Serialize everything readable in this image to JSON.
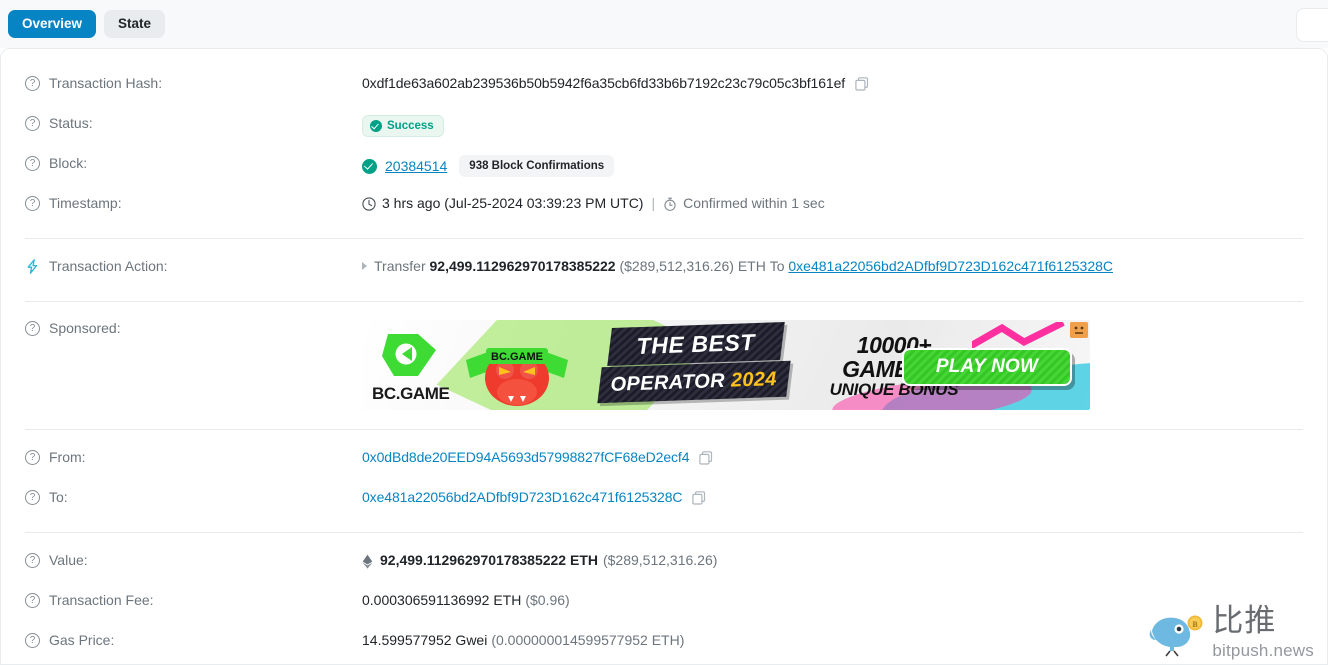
{
  "tabs": [
    {
      "label": "Overview",
      "active": true
    },
    {
      "label": "State",
      "active": false
    }
  ],
  "labels": {
    "transaction_hash": "Transaction Hash:",
    "status": "Status:",
    "block": "Block:",
    "timestamp": "Timestamp:",
    "transaction_action": "Transaction Action:",
    "sponsored": "Sponsored:",
    "from": "From:",
    "to": "To:",
    "value": "Value:",
    "transaction_fee": "Transaction Fee:",
    "gas_price": "Gas Price:"
  },
  "help_icon": "?",
  "transaction": {
    "hash": "0xdf1de63a602ab239536b50b5942f6a35cb6fd33b6b7192c23c79c05c3bf161ef",
    "status_text": "Success",
    "block_number": "20384514",
    "confirmations": "938 Block Confirmations",
    "timestamp_relative": "3 hrs ago (Jul-25-2024 03:39:23 PM UTC)",
    "timestamp_separator": "|",
    "timestamp_confirmed": "Confirmed within 1 sec",
    "from_address": "0x0dBd8de20EED94A5693d57998827fCF68eD2ecf4",
    "to_address": "0xe481a22056bd2ADfbf9D723D162c471f6125328C"
  },
  "action": {
    "verb": "Transfer",
    "amount": "92,499.112962970178385222",
    "usd": "($289,512,316.26)",
    "currency": "ETH",
    "to_word": "To",
    "to_address": "0xe481a22056bd2ADfbf9D723D162c471f6125328C"
  },
  "value": {
    "amount": "92,499.112962970178385222 ETH",
    "usd": "($289,512,316.26)"
  },
  "fee": {
    "amount": "0.000306591136992 ETH",
    "usd": "($0.96)"
  },
  "gas_price": {
    "gwei": "14.599577952 Gwei",
    "eth": "(0.000000014599577952 ETH)"
  },
  "ad": {
    "brand": "BC.GAME",
    "headline_best": "THE BEST",
    "headline_operator": "OPERATOR",
    "headline_year": "2024",
    "games_line1": "10000+",
    "games_line2": "GAMES &",
    "games_line3": "UNIQUE BONUS",
    "cta": "PLAY NOW",
    "mascot_banner": "BC.GAME"
  },
  "watermark": {
    "cn": "比推",
    "en": "bitpush.news"
  },
  "colors": {
    "accent_blue": "#0784c3",
    "success_green": "#00a186",
    "muted": "#6c757d",
    "ad_green": "#34c726",
    "ad_yellow": "#ffc21c"
  }
}
